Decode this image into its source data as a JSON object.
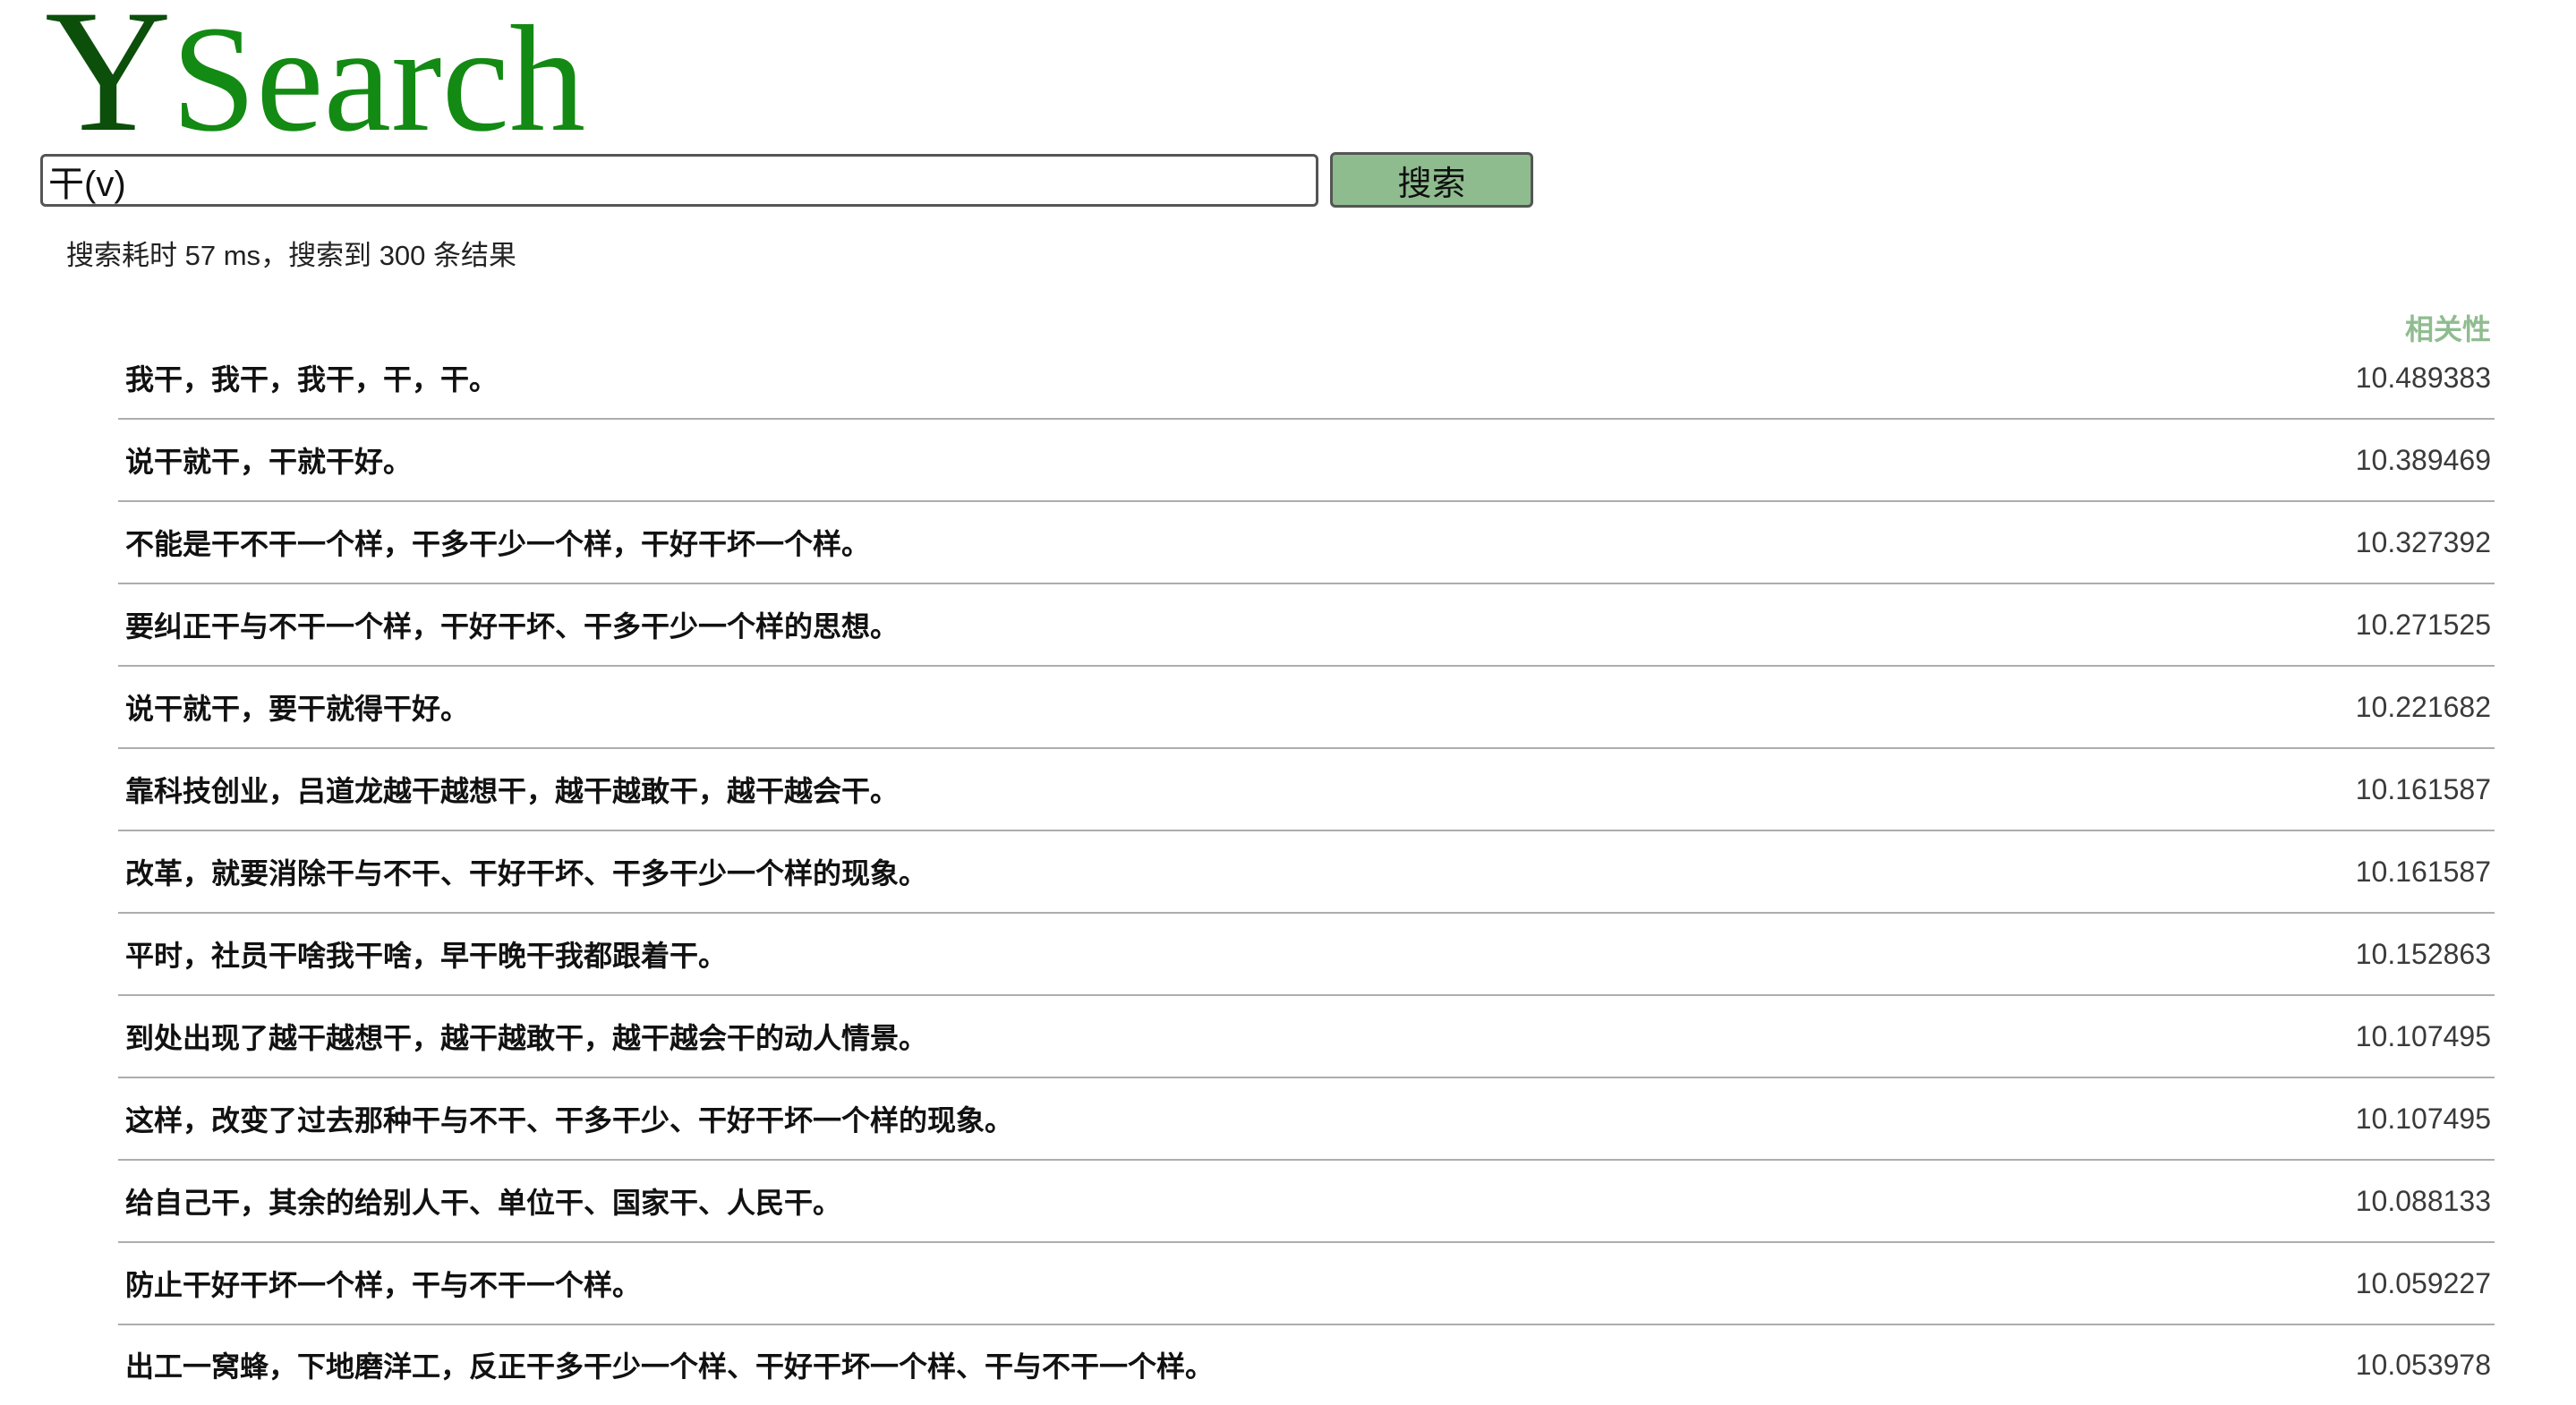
{
  "logo": {
    "first": "Y",
    "rest": "Search"
  },
  "search": {
    "query": "干(v)",
    "button_label": "搜索"
  },
  "stats": {
    "time_label": "搜索耗时",
    "time_value": "57",
    "time_unit": "ms",
    "separator": "，",
    "count_label": "搜索到",
    "count_value": "300",
    "count_unit": "条结果"
  },
  "results_header": {
    "score_label": "相关性"
  },
  "results": [
    {
      "text": "我干，我干，我干，干，干。",
      "score": "10.489383"
    },
    {
      "text": "说干就干，干就干好。",
      "score": "10.389469"
    },
    {
      "text": "不能是干不干一个样，干多干少一个样，干好干坏一个样。",
      "score": "10.327392"
    },
    {
      "text": "要纠正干与不干一个样，干好干坏、干多干少一个样的思想。",
      "score": "10.271525"
    },
    {
      "text": "说干就干，要干就得干好。",
      "score": "10.221682"
    },
    {
      "text": "靠科技创业，吕道龙越干越想干，越干越敢干，越干越会干。",
      "score": "10.161587"
    },
    {
      "text": "改革，就要消除干与不干、干好干坏、干多干少一个样的现象。",
      "score": "10.161587"
    },
    {
      "text": "平时，社员干啥我干啥，早干晚干我都跟着干。",
      "score": "10.152863"
    },
    {
      "text": "到处出现了越干越想干，越干越敢干，越干越会干的动人情景。",
      "score": "10.107495"
    },
    {
      "text": "这样，改变了过去那种干与不干、干多干少、干好干坏一个样的现象。",
      "score": "10.107495"
    },
    {
      "text": "给自己干，其余的给别人干、单位干、国家干、人民干。",
      "score": "10.088133"
    },
    {
      "text": "防止干好干坏一个样，干与不干一个样。",
      "score": "10.059227"
    },
    {
      "text": "出工一窝蜂，下地磨洋工，反正干多干少一个样、干好干坏一个样、干与不干一个样。",
      "score": "10.053978"
    }
  ],
  "colors": {
    "logo_y": "#0b4f0b",
    "logo_rest": "#138a13",
    "accent": "#8fbc8f",
    "divider": "#adadad"
  }
}
